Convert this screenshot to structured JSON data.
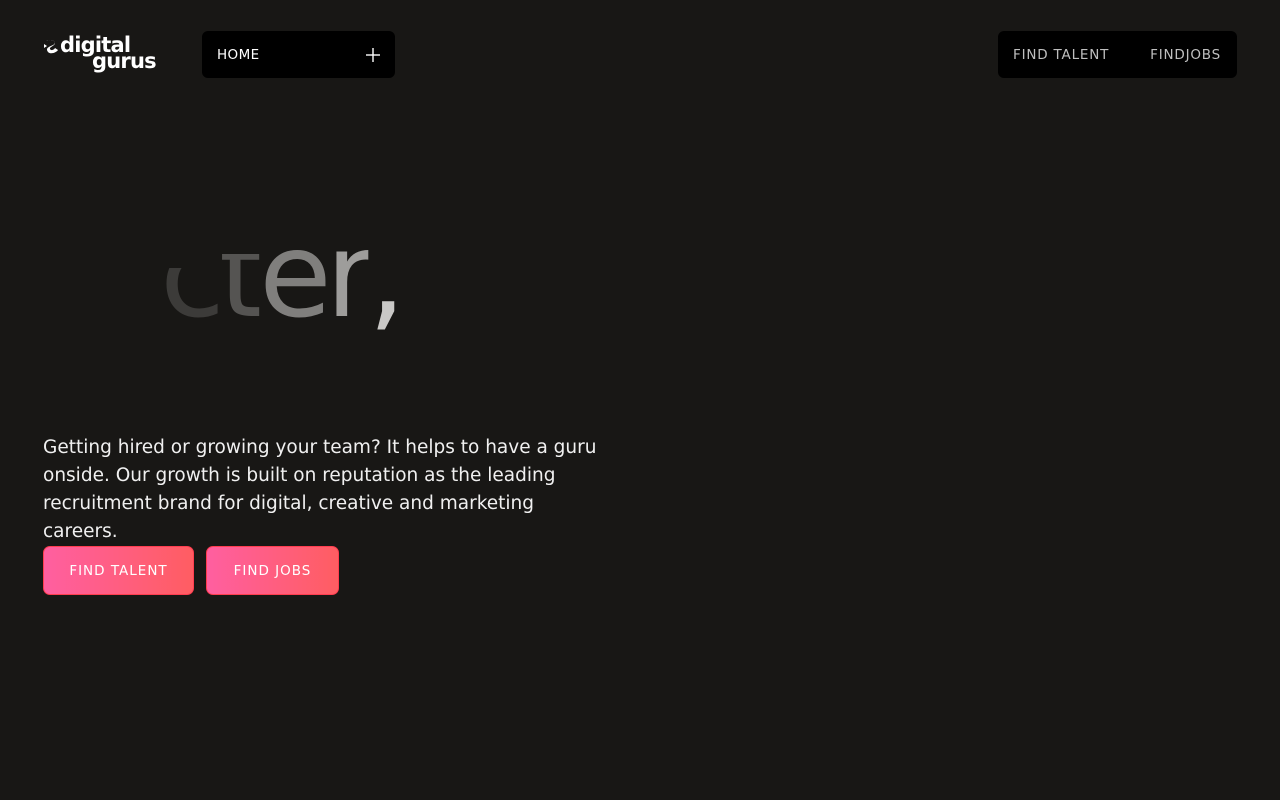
{
  "brand": {
    "name_line1": "digital",
    "name_line2": "gurus",
    "logo_icon": "dg-swirl-mark-icon"
  },
  "nav_left": {
    "label": "HOME",
    "toggle_icon": "plus-icon"
  },
  "nav_right": {
    "items": [
      {
        "label": "FIND TALENT"
      },
      {
        "label": "FINDJOBS"
      }
    ]
  },
  "hero": {
    "animated_word_fragment": "cter,",
    "description": "Getting hired or growing your team? It helps to have a guru onside. Our growth is built on reputation as the leading recruitment brand for digital, creative and marketing careers.",
    "buttons": [
      {
        "label": "FIND TALENT"
      },
      {
        "label": "FIND JOBS"
      }
    ]
  },
  "colors": {
    "background": "#181715",
    "nav_pill": "#000000",
    "cta_gradient_start": "#ff5fa0",
    "cta_gradient_end": "#ff5d62"
  }
}
